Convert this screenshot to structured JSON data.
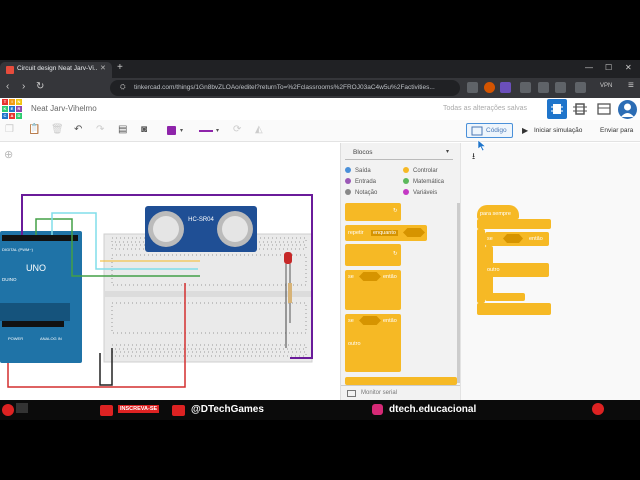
{
  "browser": {
    "tab_title": "Circuit design Neat Jarv-Vi...",
    "url": "tinkercad.com/things/1Gn8bvZLOAo/editel?returnTo=%2Fclassrooms%2FROJ03aC4w5u%2Factivities...",
    "vpn_label": "VPN"
  },
  "app": {
    "project_title": "Neat Jarv-Vihelmo",
    "save_status": "Todas as alterações salvas",
    "logo_letters": [
      "TIN",
      "KER",
      "CAD"
    ],
    "toolbar": {
      "code_label": "Código",
      "start_sim_label": "Iniciar simulação",
      "send_label": "Enviar para"
    },
    "colors": {
      "accent": "#8e24aa",
      "brand_blue": "#1f75cb"
    }
  },
  "components": {
    "sensor_label": "HC-SR04",
    "arduino_label": "UNO",
    "arduino_brand": "DUINO",
    "digital_label": "DIGITAL (PWM~)",
    "power_label": "POWER",
    "analog_label": "ANALOG IN"
  },
  "blocks_panel": {
    "selected_category": "Blocos",
    "categories": [
      {
        "label": "Saída",
        "color": "#4a90d9"
      },
      {
        "label": "Controlar",
        "color": "#f6b925"
      },
      {
        "label": "Entrada",
        "color": "#9b59b6"
      },
      {
        "label": "Matemática",
        "color": "#5cb85c"
      },
      {
        "label": "Notação",
        "color": "#888888"
      },
      {
        "label": "Variáveis",
        "color": "#c439c4"
      }
    ],
    "blocks": {
      "repeat": "repetir",
      "repeat_mode": "enquanto",
      "if_label": "se",
      "then_label": "então",
      "else_label": "outro"
    },
    "serial_monitor": "Monitor serial"
  },
  "script": {
    "forever_label": "para sempre",
    "if_label": "se",
    "then_label": "então",
    "else_label": "outro"
  },
  "banner": {
    "subscribe": "INSCREVA-SE",
    "youtube_handle": "@DTechGames",
    "instagram_handle": "dtech.educacional"
  }
}
